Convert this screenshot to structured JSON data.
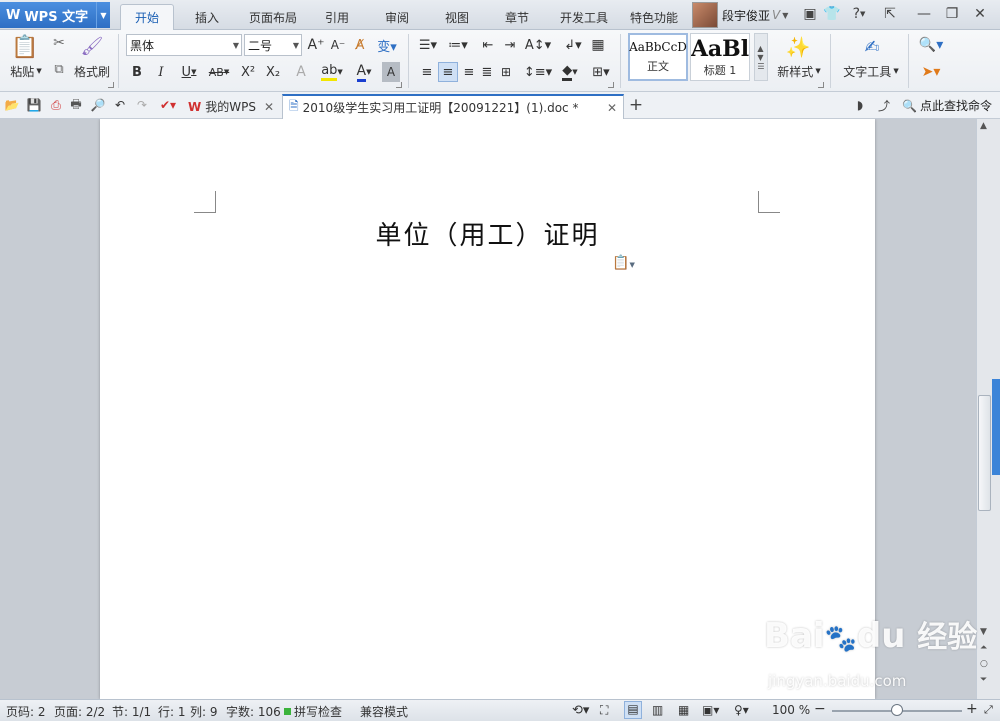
{
  "app": {
    "logo": "W",
    "name": "WPS 文字",
    "ribbon_tabs": [
      {
        "label": "开始",
        "active": true
      },
      {
        "label": "插入"
      },
      {
        "label": "页面布局"
      },
      {
        "label": "引用"
      },
      {
        "label": "审阅"
      },
      {
        "label": "视图"
      },
      {
        "label": "章节"
      },
      {
        "label": "开发工具"
      },
      {
        "label": "特色功能"
      }
    ],
    "user": {
      "name": "段宇俊亚",
      "vip": "V"
    }
  },
  "ribbon": {
    "paste": "粘贴",
    "format_painter": "格式刷",
    "font_family": "黑体",
    "font_size": "二号",
    "bold": "B",
    "italic": "I",
    "underline": "U",
    "strike": "AB",
    "superscript": "X²",
    "subscript": "X₂",
    "styles": [
      {
        "sample": "AaBbCcD",
        "name": "正文",
        "selected": true
      },
      {
        "sample": "AaBl",
        "name": "标题 1",
        "selected": false
      }
    ],
    "new_style": "新样式",
    "text_tools": "文字工具"
  },
  "quickbar": {
    "tabs": [
      {
        "label": "我的WPS",
        "active": false
      },
      {
        "label": "2010级学生实习用工证明【20091221】(1).doc *",
        "active": true
      }
    ],
    "add_tab": "+",
    "search_cmd": "点此查找命令"
  },
  "document": {
    "title": "单位（用工）证明"
  },
  "statusbar": {
    "page_no": "页码: 2",
    "pages": "页面: 2/2",
    "section": "节: 1/1",
    "row": "行: 1",
    "col": "列: 9",
    "word_count": "字数: 106",
    "spell_check": "拼写检查",
    "compat_mode": "兼容模式",
    "zoom": "100 %",
    "zoom_fraction": 0.5
  },
  "watermark": {
    "brand": "Bai",
    "brand2": "du",
    "cn": "经验",
    "url": "jingyan.baidu.com"
  },
  "colors": {
    "accent": "#2e6fc4",
    "ribbon_bg": "#f0f2f5",
    "workspace_bg": "#c7ccd3"
  }
}
